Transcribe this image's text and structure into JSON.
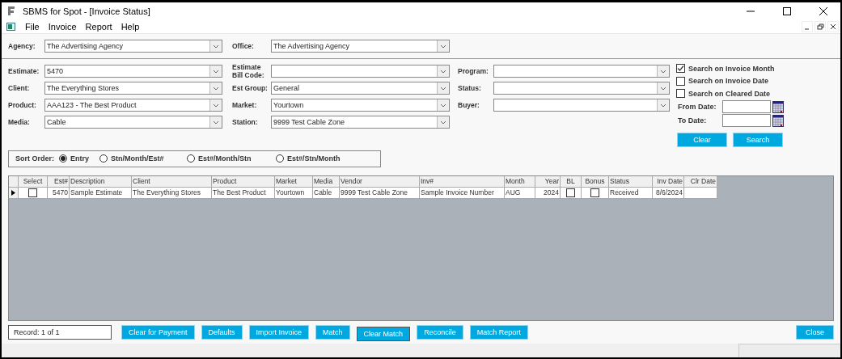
{
  "window": {
    "title": "SBMS for Spot - [Invoice Status]"
  },
  "menu": [
    "File",
    "Invoice",
    "Report",
    "Help"
  ],
  "header_fields": [
    {
      "label": "Agency:",
      "value": "The Advertising Agency"
    },
    {
      "label": "Office:",
      "value": "The Advertising Agency"
    }
  ],
  "filter_columns": [
    [
      {
        "label": "Estimate:",
        "value": "5470"
      },
      {
        "label": "Client:",
        "value": "The Everything Stores"
      },
      {
        "label": "Product:",
        "value": "AAA123 - The Best Product"
      },
      {
        "label": "Media:",
        "value": "Cable"
      }
    ],
    [
      {
        "label": "Estimate Bill Code:"
      },
      {
        "label": "Est Group:",
        "value": "General"
      },
      {
        "label": "Market:",
        "value": "Yourtown"
      },
      {
        "label": "Station:",
        "value": "9999 Test Cable Zone"
      }
    ],
    [
      {
        "label": "Program:"
      },
      {
        "label": "Status:"
      },
      {
        "label": "Buyer:"
      }
    ]
  ],
  "search_options": [
    {
      "label": "Search on Invoice Month",
      "checked": true
    },
    {
      "label": "Search on Invoice Date",
      "checked": false
    },
    {
      "label": "Search on Cleared Date",
      "checked": false
    }
  ],
  "date_fields": [
    {
      "label": "From Date:"
    },
    {
      "label": "To Date:"
    }
  ],
  "search_buttons": [
    "Clear",
    "Search"
  ],
  "sort_order": {
    "label": "Sort Order:",
    "options": [
      {
        "label": "Entry",
        "selected": true
      },
      {
        "label": "Stn/Month/Est#",
        "selected": false
      },
      {
        "label": "Est#/Month/Stn",
        "selected": false
      },
      {
        "label": "Est#/Stn/Month",
        "selected": false
      }
    ]
  },
  "grid": {
    "columns": [
      {
        "label": "Select",
        "kind": "check"
      },
      {
        "label": "Est#",
        "kind": "number"
      },
      {
        "label": "Description",
        "kind": "text"
      },
      {
        "label": "Client",
        "kind": "text"
      },
      {
        "label": "Product",
        "kind": "text"
      },
      {
        "label": "Market",
        "kind": "text"
      },
      {
        "label": "Media",
        "kind": "text"
      },
      {
        "label": "Vendor",
        "kind": "text"
      },
      {
        "label": "Inv#",
        "kind": "text"
      },
      {
        "label": "Month",
        "kind": "text"
      },
      {
        "label": "Year",
        "kind": "number"
      },
      {
        "label": "BL",
        "kind": "check"
      },
      {
        "label": "Bonus",
        "kind": "check"
      },
      {
        "label": "Status",
        "kind": "text"
      },
      {
        "label": "Inv Date",
        "kind": "number"
      },
      {
        "label": "Clr Date",
        "kind": "number"
      }
    ],
    "rows": [
      {
        "current": true,
        "cells": [
          {
            "checked": false
          },
          {
            "text": "5470"
          },
          {
            "text": "Sample Estimate"
          },
          {
            "text": "The Everything Stores"
          },
          {
            "text": "The Best Product"
          },
          {
            "text": "Yourtown"
          },
          {
            "text": "Cable"
          },
          {
            "text": "9999 Test Cable Zone"
          },
          {
            "text": "Sample Invoice Number"
          },
          {
            "text": "AUG"
          },
          {
            "text": "2024"
          },
          {
            "checked": false
          },
          {
            "checked": false
          },
          {
            "text": "Received"
          },
          {
            "text": "8/6/2024"
          },
          {}
        ]
      }
    ]
  },
  "record": "Record:  1 of 1",
  "actions": [
    {
      "label": "Clear for Payment",
      "focused": false
    },
    {
      "label": "Defaults",
      "focused": false
    },
    {
      "label": "Import Invoice",
      "focused": false
    },
    {
      "label": "Match",
      "focused": false
    },
    {
      "label": "Clear Match",
      "focused": true
    },
    {
      "label": "Reconcile",
      "focused": false
    },
    {
      "label": "Match Report",
      "focused": false
    }
  ],
  "close_button": "Close"
}
